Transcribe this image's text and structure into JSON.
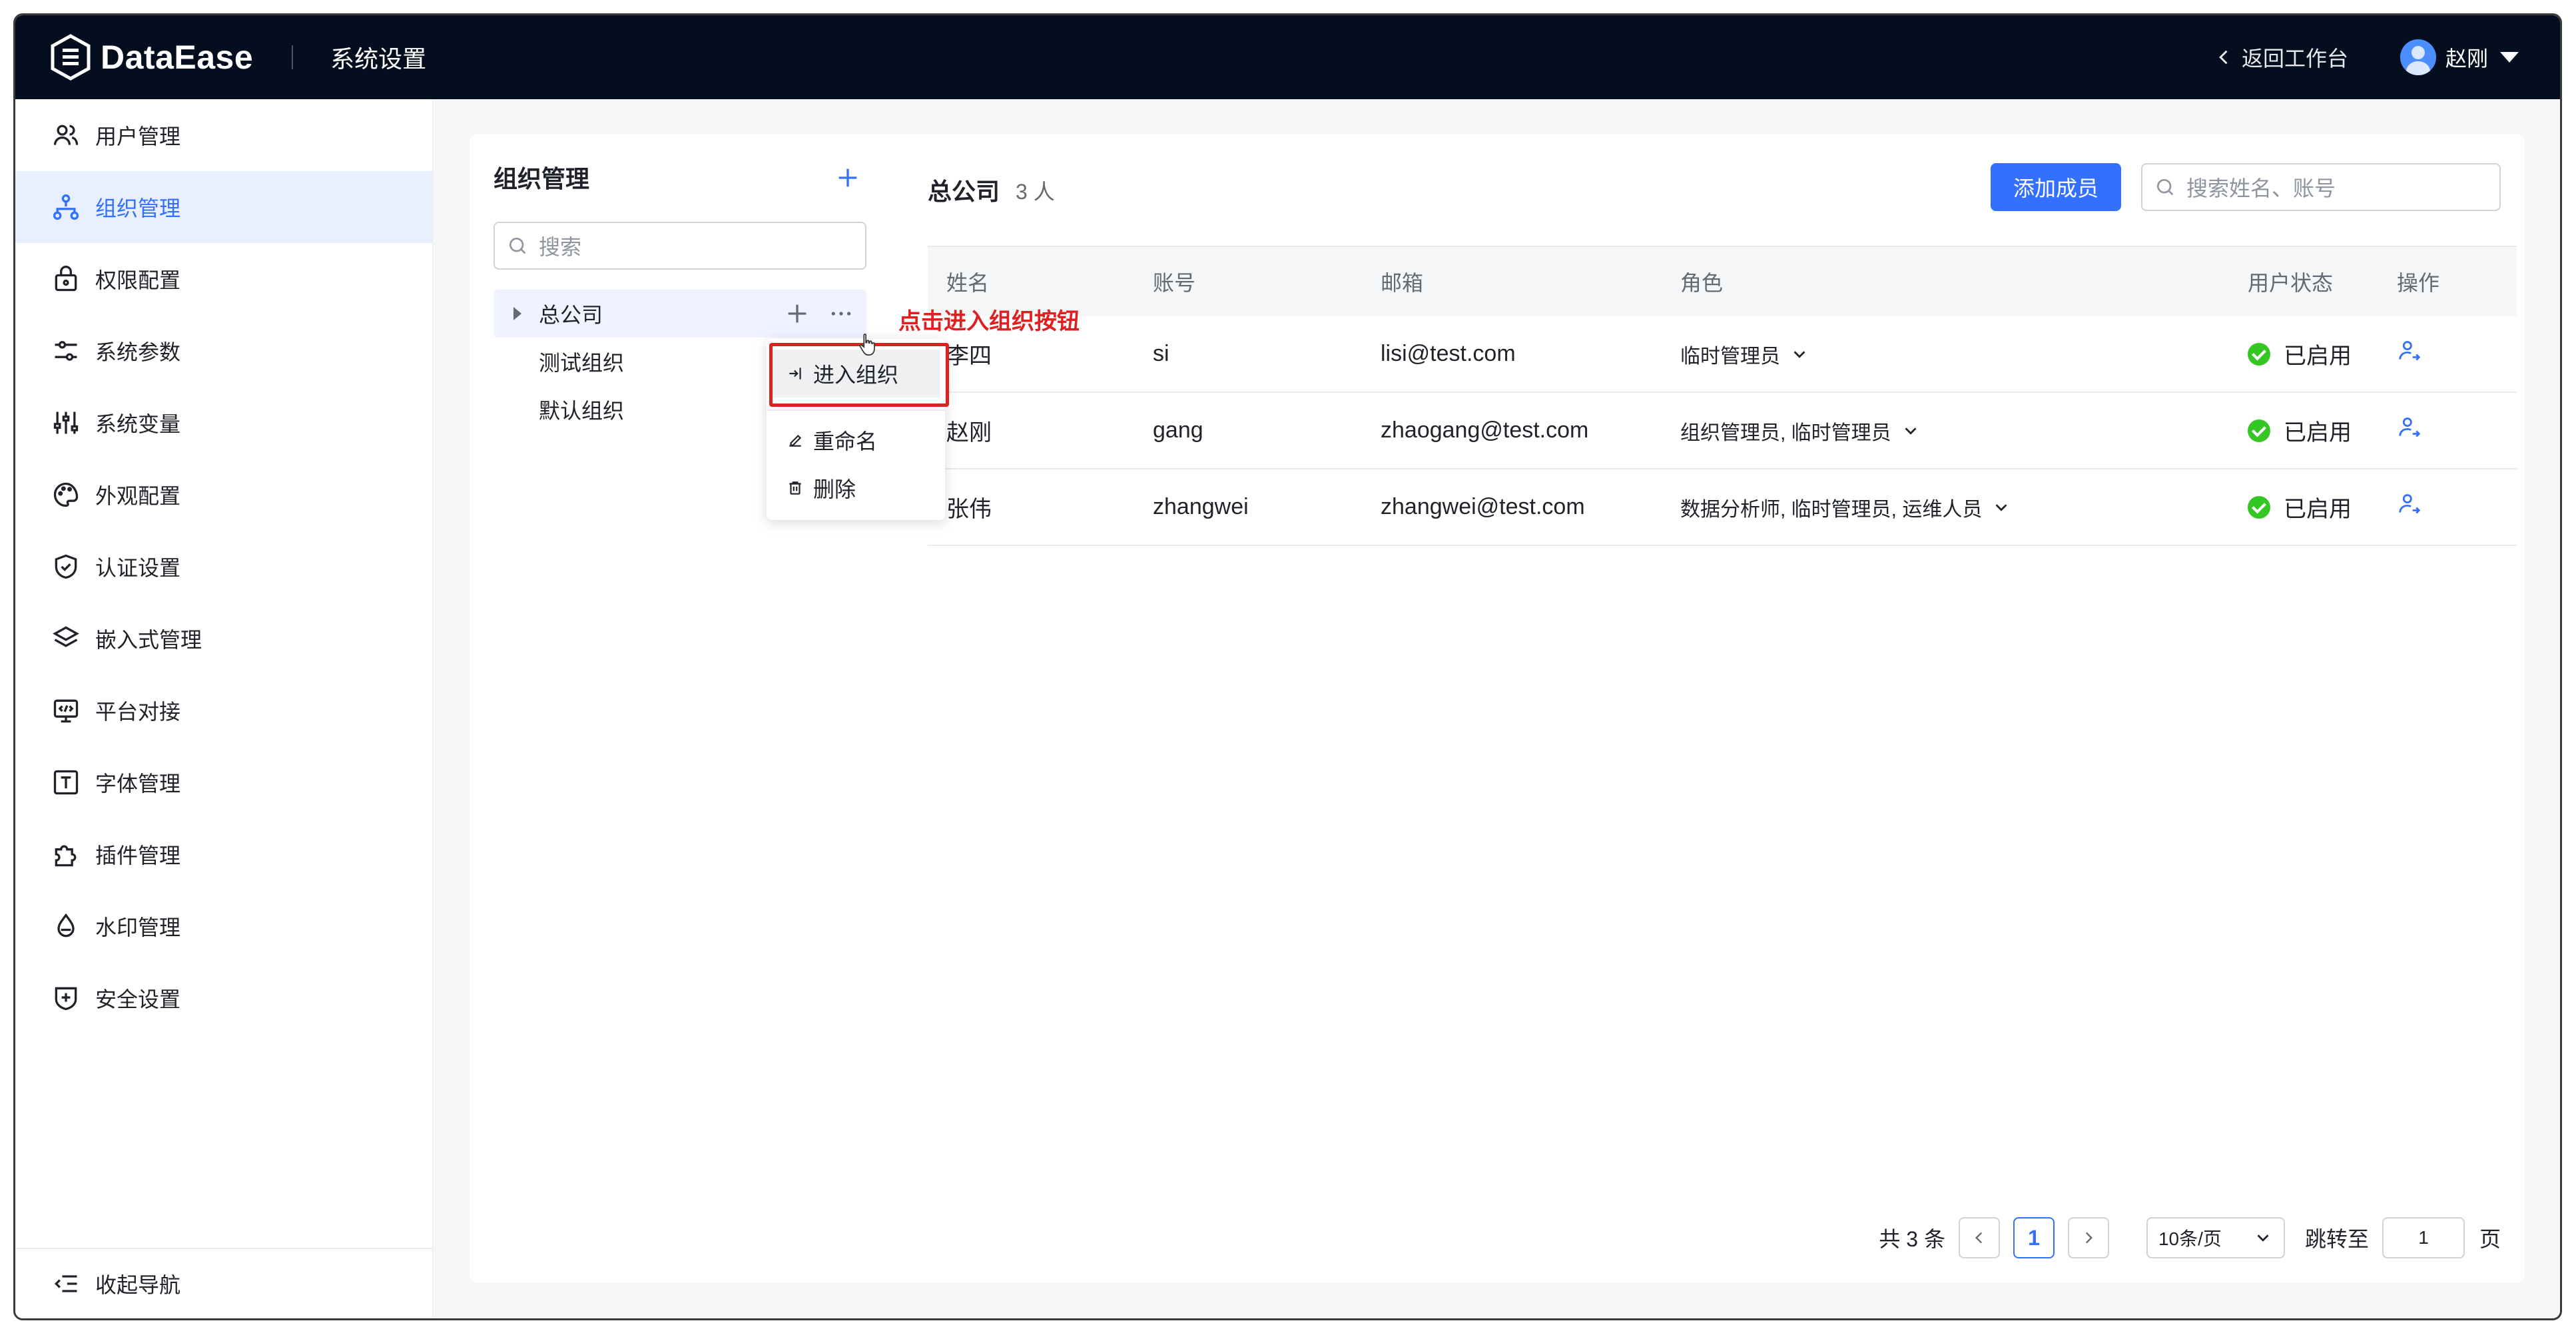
{
  "header": {
    "logo_text": "DataEase",
    "title": "系统设置",
    "back_label": "返回工作台",
    "user_name": "赵刚"
  },
  "sidebar": {
    "items": [
      {
        "label": "用户管理",
        "icon": "users-icon"
      },
      {
        "label": "组织管理",
        "icon": "org-icon",
        "active": true
      },
      {
        "label": "权限配置",
        "icon": "lock-icon"
      },
      {
        "label": "系统参数",
        "icon": "sliders-icon"
      },
      {
        "label": "系统变量",
        "icon": "variables-icon"
      },
      {
        "label": "外观配置",
        "icon": "palette-icon"
      },
      {
        "label": "认证设置",
        "icon": "shield-check-icon"
      },
      {
        "label": "嵌入式管理",
        "icon": "layers-icon"
      },
      {
        "label": "平台对接",
        "icon": "monitor-code-icon"
      },
      {
        "label": "字体管理",
        "icon": "font-icon"
      },
      {
        "label": "插件管理",
        "icon": "puzzle-icon"
      },
      {
        "label": "水印管理",
        "icon": "drop-icon"
      },
      {
        "label": "安全设置",
        "icon": "shield-plus-icon"
      }
    ],
    "collapse_label": "收起导航"
  },
  "org_panel": {
    "title": "组织管理",
    "search_placeholder": "搜索",
    "tree": [
      {
        "label": "总公司",
        "selected": true
      },
      {
        "label": "测试组织"
      },
      {
        "label": "默认组织"
      }
    ],
    "menu": {
      "enter": "进入组织",
      "rename": "重命名",
      "delete": "删除"
    },
    "annotation": "点击进入组织按钮"
  },
  "members": {
    "title": "总公司",
    "count": "3 人",
    "add_button": "添加成员",
    "search_placeholder": "搜索姓名、账号",
    "columns": [
      "姓名",
      "账号",
      "邮箱",
      "角色",
      "用户状态",
      "操作"
    ],
    "rows": [
      {
        "name": "李四",
        "account": "si",
        "email": "lisi@test.com",
        "role": "临时管理员",
        "status": "已启用"
      },
      {
        "name": "赵刚",
        "account": "gang",
        "email": "zhaogang@test.com",
        "role": "组织管理员, 临时管理员",
        "status": "已启用"
      },
      {
        "name": "张伟",
        "account": "zhangwei",
        "email": "zhangwei@test.com",
        "role": "数据分析师, 临时管理员, 运维人员",
        "status": "已启用"
      }
    ],
    "status_color": "#34c724"
  },
  "pagination": {
    "total": "共 3 条",
    "current_page": "1",
    "page_size": "10条/页",
    "jump_label": "跳转至",
    "jump_value": "1",
    "page_suffix": "页"
  },
  "colors": {
    "primary": "#3370ff",
    "header_bg": "#050e1f",
    "annotation": "#e02020"
  }
}
